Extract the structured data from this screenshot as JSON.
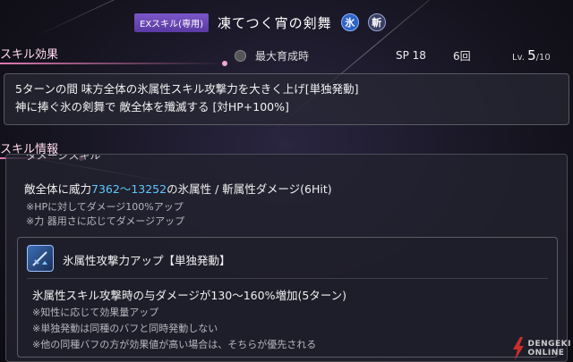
{
  "header": {
    "ex_tag": "EXスキル(専用)",
    "skill_name": "凍てつく宵の剣舞",
    "elements": [
      {
        "label": "氷",
        "icon": "ice-element-icon"
      },
      {
        "label": "斬",
        "icon": "slash-element-icon"
      }
    ]
  },
  "skill_effect": {
    "title": "スキル効果",
    "max_growth_label": "最大育成時",
    "sp": "SP 18",
    "uses": "6回",
    "level_prefix": "Lv.",
    "level_current": "5",
    "level_max": "/10",
    "lines": [
      "5ターンの間 味方全体の氷属性スキル攻撃力を大きく上げ[単独発動]",
      "神に捧ぐ氷の剣舞で 敵全体を殲滅する [対HP+100%]"
    ]
  },
  "skill_info": {
    "title": "スキル情報",
    "cut_heading": "ダメージスキル",
    "damage_prefix": "敵全体に威力",
    "damage_range": "7362〜13252",
    "damage_suffix": "の氷属性 / 斬属性ダメージ(6Hit)",
    "notes": [
      "※HPに対してダメージ100%アップ",
      "※力 器用さに応じてダメージアップ"
    ],
    "sub_effect": {
      "title": "氷属性攻撃力アップ【単独発動】",
      "desc": "氷属性スキル攻撃時の与ダメージが130〜160%増加(5ターン)",
      "notes": [
        "※知性に応じて効果量アップ",
        "※単独発動は同種のバフと同時発動しない",
        "※他の同種バフの方が効果値が高い場合は、そちらが優先される"
      ]
    }
  },
  "watermark": {
    "line1": "DENGEKI",
    "line2": "ONLINE"
  },
  "colors": {
    "accent_pink": "#e07ab4",
    "highlight_blue": "#5ec8ff",
    "ex_tag_purple": "#6b48b8",
    "watermark_red": "#e8322c"
  }
}
